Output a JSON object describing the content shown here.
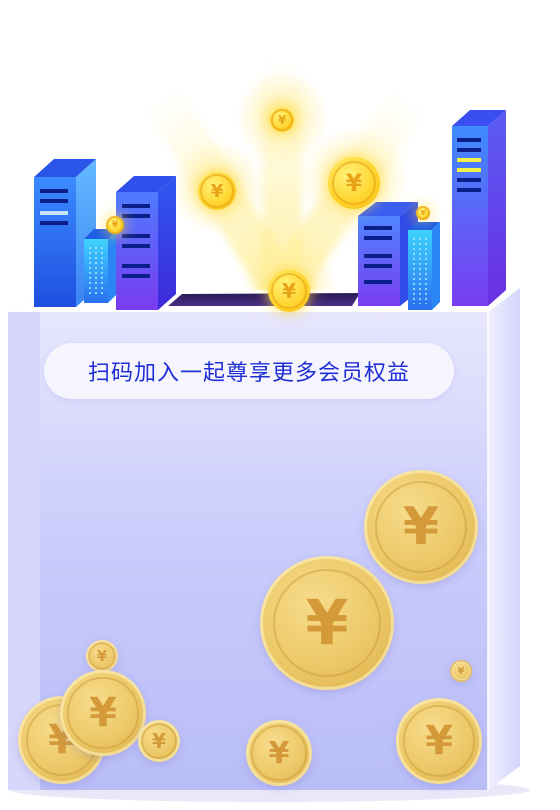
{
  "banner": {
    "title": "扫码加入一起尊享更多会员权益"
  },
  "colors": {
    "box_front": "#c9cbfb",
    "box_side": "#dcdcfb",
    "pill_bg": "#f6f5fe",
    "title_text": "#1f2fd6",
    "coin_gold": "#ecc866",
    "building_blue": "#2c63f0",
    "building_purple": "#7b46f2"
  },
  "coin_symbol": "¥"
}
